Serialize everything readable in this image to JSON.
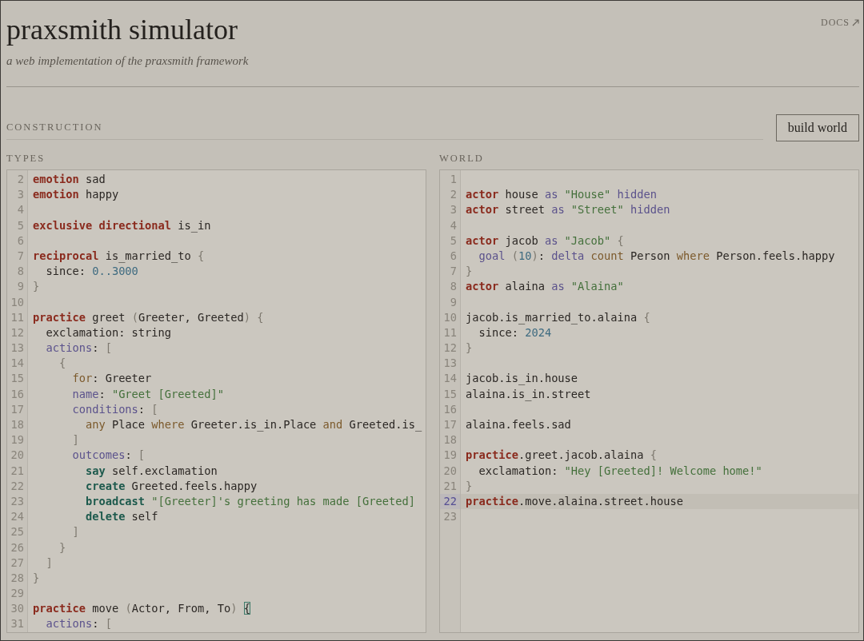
{
  "header": {
    "title": "praxsmith simulator",
    "subtitle": "a web implementation of the praxsmith framework",
    "docs_link": "DOCS"
  },
  "construction": {
    "heading": "CONSTRUCTION",
    "build_button": "build world"
  },
  "editors": [
    {
      "label": "TYPES",
      "lines": [
        {
          "number": "2",
          "active": false,
          "tokens": [
            {
              "kind": "keyword",
              "text": "emotion"
            },
            {
              "kind": "plain",
              "text": " sad"
            }
          ]
        },
        {
          "number": "3",
          "active": false,
          "tokens": [
            {
              "kind": "keyword",
              "text": "emotion"
            },
            {
              "kind": "plain",
              "text": " happy"
            }
          ]
        },
        {
          "number": "4",
          "active": false
        },
        {
          "number": "5",
          "active": false,
          "tokens": [
            {
              "kind": "keyword",
              "text": "exclusive directional"
            },
            {
              "kind": "plain",
              "text": " is_in"
            }
          ]
        },
        {
          "number": "6",
          "active": false
        },
        {
          "number": "7",
          "active": false,
          "tokens": [
            {
              "kind": "keyword",
              "text": "reciprocal"
            },
            {
              "kind": "plain",
              "text": " is_married_to "
            },
            {
              "kind": "punct",
              "text": "{"
            }
          ]
        },
        {
          "number": "8",
          "active": false,
          "tokens": [
            {
              "kind": "plain",
              "text": "  since: "
            },
            {
              "kind": "number",
              "text": "0..3000"
            }
          ]
        },
        {
          "number": "9",
          "active": false,
          "tokens": [
            {
              "kind": "punct",
              "text": "}"
            }
          ]
        },
        {
          "number": "10",
          "active": false
        },
        {
          "number": "11",
          "active": false,
          "tokens": [
            {
              "kind": "keyword",
              "text": "practice"
            },
            {
              "kind": "plain",
              "text": " greet "
            },
            {
              "kind": "punct",
              "text": "("
            },
            {
              "kind": "plain",
              "text": "Greeter, Greeted"
            },
            {
              "kind": "punct",
              "text": ")"
            },
            {
              "kind": "punct",
              "text": " {"
            }
          ]
        },
        {
          "number": "12",
          "active": false,
          "tokens": [
            {
              "kind": "plain",
              "text": "  exclamation: string"
            }
          ]
        },
        {
          "number": "13",
          "active": false,
          "tokens": [
            {
              "kind": "property",
              "text": "  actions"
            },
            {
              "kind": "plain",
              "text": ": "
            },
            {
              "kind": "punct",
              "text": "["
            }
          ]
        },
        {
          "number": "14",
          "active": false,
          "tokens": [
            {
              "kind": "punct",
              "text": "    {"
            }
          ]
        },
        {
          "number": "15",
          "active": false,
          "tokens": [
            {
              "kind": "control",
              "text": "      for"
            },
            {
              "kind": "plain",
              "text": ": Greeter"
            }
          ]
        },
        {
          "number": "16",
          "active": false,
          "tokens": [
            {
              "kind": "property",
              "text": "      name"
            },
            {
              "kind": "plain",
              "text": ": "
            },
            {
              "kind": "string",
              "text": "\"Greet [Greeted]\""
            }
          ]
        },
        {
          "number": "17",
          "active": false,
          "tokens": [
            {
              "kind": "property",
              "text": "      conditions"
            },
            {
              "kind": "plain",
              "text": ": "
            },
            {
              "kind": "punct",
              "text": "["
            }
          ]
        },
        {
          "number": "18",
          "active": false,
          "tokens": [
            {
              "kind": "control",
              "text": "        any"
            },
            {
              "kind": "plain",
              "text": " Place "
            },
            {
              "kind": "control",
              "text": "where"
            },
            {
              "kind": "plain",
              "text": " Greeter.is_in.Place "
            },
            {
              "kind": "control",
              "text": "and"
            },
            {
              "kind": "plain",
              "text": " Greeted.is_"
            }
          ]
        },
        {
          "number": "19",
          "active": false,
          "tokens": [
            {
              "kind": "punct",
              "text": "      ]"
            }
          ]
        },
        {
          "number": "20",
          "active": false,
          "tokens": [
            {
              "kind": "property",
              "text": "      outcomes"
            },
            {
              "kind": "plain",
              "text": ": "
            },
            {
              "kind": "punct",
              "text": "["
            }
          ]
        },
        {
          "number": "21",
          "active": false,
          "tokens": [
            {
              "kind": "effect",
              "text": "        say"
            },
            {
              "kind": "plain",
              "text": " self.exclamation"
            }
          ]
        },
        {
          "number": "22",
          "active": false,
          "tokens": [
            {
              "kind": "effect",
              "text": "        create"
            },
            {
              "kind": "plain",
              "text": " Greeted.feels.happy"
            }
          ]
        },
        {
          "number": "23",
          "active": false,
          "tokens": [
            {
              "kind": "effect",
              "text": "        broadcast"
            },
            {
              "kind": "string",
              "text": " \"[Greeter]'s greeting has made [Greeted]"
            }
          ]
        },
        {
          "number": "24",
          "active": false,
          "tokens": [
            {
              "kind": "effect",
              "text": "        delete"
            },
            {
              "kind": "plain",
              "text": " self"
            }
          ]
        },
        {
          "number": "25",
          "active": false,
          "tokens": [
            {
              "kind": "punct",
              "text": "      ]"
            }
          ]
        },
        {
          "number": "26",
          "active": false,
          "tokens": [
            {
              "kind": "punct",
              "text": "    }"
            }
          ]
        },
        {
          "number": "27",
          "active": false,
          "tokens": [
            {
              "kind": "punct",
              "text": "  ]"
            }
          ]
        },
        {
          "number": "28",
          "active": false,
          "tokens": [
            {
              "kind": "punct",
              "text": "}"
            }
          ]
        },
        {
          "number": "29",
          "active": false
        },
        {
          "number": "30",
          "active": false,
          "tokens": [
            {
              "kind": "keyword",
              "text": "practice"
            },
            {
              "kind": "plain",
              "text": " move "
            },
            {
              "kind": "punct",
              "text": "("
            },
            {
              "kind": "plain",
              "text": "Actor, From, To"
            },
            {
              "kind": "punct",
              "text": ") "
            },
            {
              "kind": "matched-bracket",
              "text": "{"
            }
          ]
        },
        {
          "number": "31",
          "active": false,
          "tokens": [
            {
              "kind": "property",
              "text": "  actions"
            },
            {
              "kind": "plain",
              "text": ": "
            },
            {
              "kind": "punct",
              "text": "["
            }
          ]
        }
      ]
    },
    {
      "label": "WORLD",
      "lines": [
        {
          "number": "1",
          "active": false
        },
        {
          "number": "2",
          "active": false,
          "tokens": [
            {
              "kind": "keyword",
              "text": "actor"
            },
            {
              "kind": "plain",
              "text": " house "
            },
            {
              "kind": "property",
              "text": "as"
            },
            {
              "kind": "string",
              "text": " \"House\""
            },
            {
              "kind": "property",
              "text": " hidden"
            }
          ]
        },
        {
          "number": "3",
          "active": false,
          "tokens": [
            {
              "kind": "keyword",
              "text": "actor"
            },
            {
              "kind": "plain",
              "text": " street "
            },
            {
              "kind": "property",
              "text": "as"
            },
            {
              "kind": "string",
              "text": " \"Street\""
            },
            {
              "kind": "property",
              "text": " hidden"
            }
          ]
        },
        {
          "number": "4",
          "active": false
        },
        {
          "number": "5",
          "active": false,
          "tokens": [
            {
              "kind": "keyword",
              "text": "actor"
            },
            {
              "kind": "plain",
              "text": " jacob "
            },
            {
              "kind": "property",
              "text": "as"
            },
            {
              "kind": "string",
              "text": " \"Jacob\""
            },
            {
              "kind": "punct",
              "text": " {"
            }
          ]
        },
        {
          "number": "6",
          "active": false,
          "tokens": [
            {
              "kind": "property",
              "text": "  goal"
            },
            {
              "kind": "punct",
              "text": " ("
            },
            {
              "kind": "number",
              "text": "10"
            },
            {
              "kind": "punct",
              "text": ")"
            },
            {
              "kind": "plain",
              "text": ": "
            },
            {
              "kind": "property",
              "text": "delta"
            },
            {
              "kind": "control",
              "text": " count"
            },
            {
              "kind": "plain",
              "text": " Person "
            },
            {
              "kind": "control",
              "text": "where"
            },
            {
              "kind": "plain",
              "text": " Person.feels.happy"
            }
          ]
        },
        {
          "number": "7",
          "active": false,
          "tokens": [
            {
              "kind": "punct",
              "text": "}"
            }
          ]
        },
        {
          "number": "8",
          "active": false,
          "tokens": [
            {
              "kind": "keyword",
              "text": "actor"
            },
            {
              "kind": "plain",
              "text": " alaina "
            },
            {
              "kind": "property",
              "text": "as"
            },
            {
              "kind": "string",
              "text": " \"Alaina\""
            }
          ]
        },
        {
          "number": "9",
          "active": false
        },
        {
          "number": "10",
          "active": false,
          "tokens": [
            {
              "kind": "plain",
              "text": "jacob.is_married_to.alaina "
            },
            {
              "kind": "punct",
              "text": "{"
            }
          ]
        },
        {
          "number": "11",
          "active": false,
          "tokens": [
            {
              "kind": "plain",
              "text": "  since: "
            },
            {
              "kind": "number",
              "text": "2024"
            }
          ]
        },
        {
          "number": "12",
          "active": false,
          "tokens": [
            {
              "kind": "punct",
              "text": "}"
            }
          ]
        },
        {
          "number": "13",
          "active": false
        },
        {
          "number": "14",
          "active": false,
          "tokens": [
            {
              "kind": "plain",
              "text": "jacob.is_in.house"
            }
          ]
        },
        {
          "number": "15",
          "active": false,
          "tokens": [
            {
              "kind": "plain",
              "text": "alaina.is_in.street"
            }
          ]
        },
        {
          "number": "16",
          "active": false
        },
        {
          "number": "17",
          "active": false,
          "tokens": [
            {
              "kind": "plain",
              "text": "alaina.feels.sad"
            }
          ]
        },
        {
          "number": "18",
          "active": false
        },
        {
          "number": "19",
          "active": false,
          "tokens": [
            {
              "kind": "keyword",
              "text": "practice"
            },
            {
              "kind": "plain",
              "text": ".greet.jacob.alaina "
            },
            {
              "kind": "punct",
              "text": "{"
            }
          ]
        },
        {
          "number": "20",
          "active": false,
          "tokens": [
            {
              "kind": "plain",
              "text": "  exclamation: "
            },
            {
              "kind": "string",
              "text": "\"Hey [Greeted]! Welcome home!\""
            }
          ]
        },
        {
          "number": "21",
          "active": false,
          "tokens": [
            {
              "kind": "punct",
              "text": "}"
            }
          ]
        },
        {
          "number": "22",
          "active": true,
          "tokens": [
            {
              "kind": "keyword",
              "text": "practice"
            },
            {
              "kind": "plain",
              "text": ".move.alaina.street.house"
            }
          ]
        },
        {
          "number": "23",
          "active": false
        }
      ]
    }
  ]
}
